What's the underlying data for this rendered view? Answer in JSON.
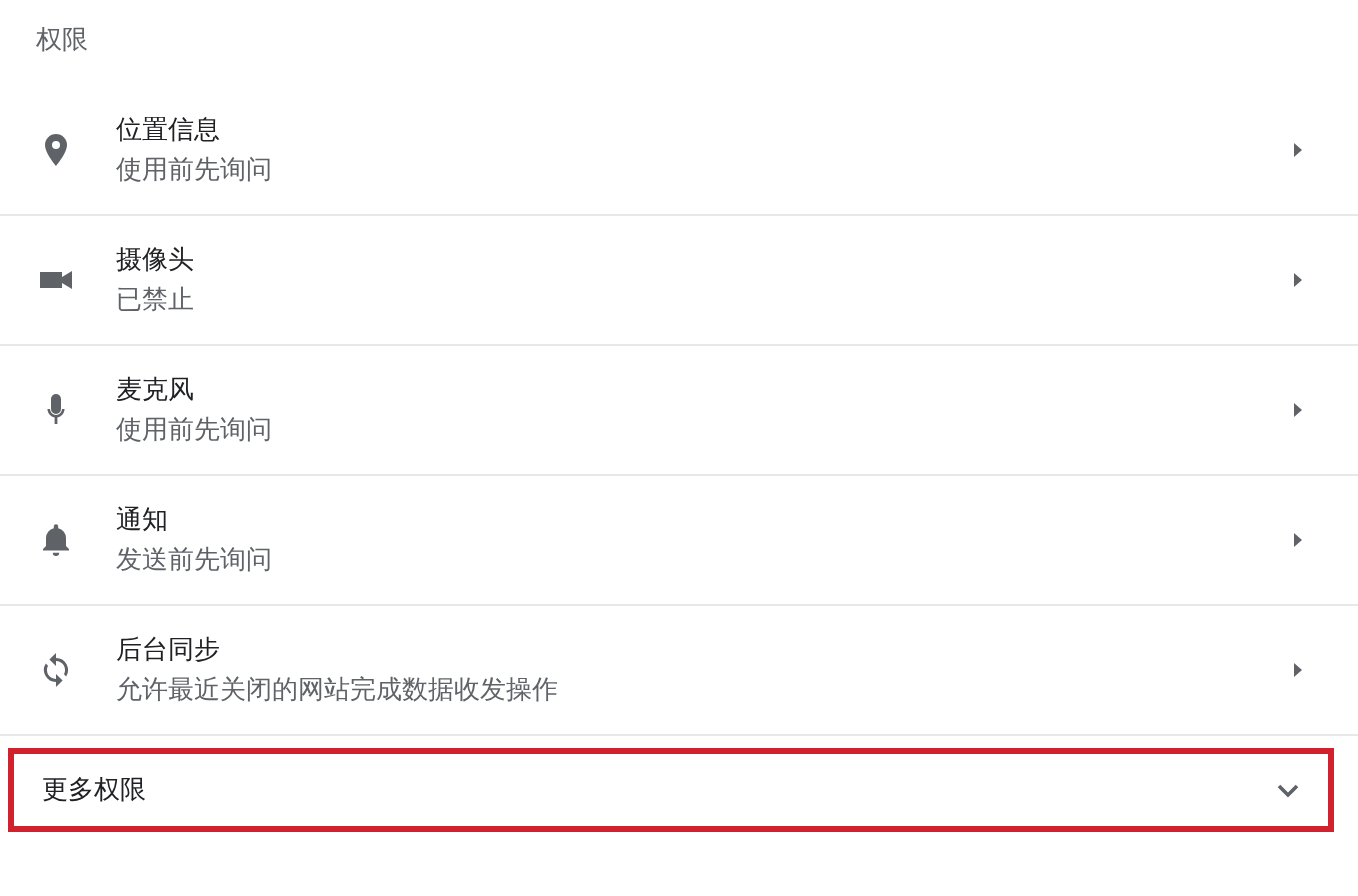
{
  "section_title": "权限",
  "permissions": [
    {
      "kind": "location",
      "title": "位置信息",
      "status": "使用前先询问"
    },
    {
      "kind": "camera",
      "title": "摄像头",
      "status": "已禁止"
    },
    {
      "kind": "microphone",
      "title": "麦克风",
      "status": "使用前先询问"
    },
    {
      "kind": "notifications",
      "title": "通知",
      "status": "发送前先询问"
    },
    {
      "kind": "sync",
      "title": "后台同步",
      "status": "允许最近关闭的网站完成数据收发操作"
    }
  ],
  "more_permissions": {
    "label": "更多权限",
    "expanded": false,
    "highlighted": true
  }
}
